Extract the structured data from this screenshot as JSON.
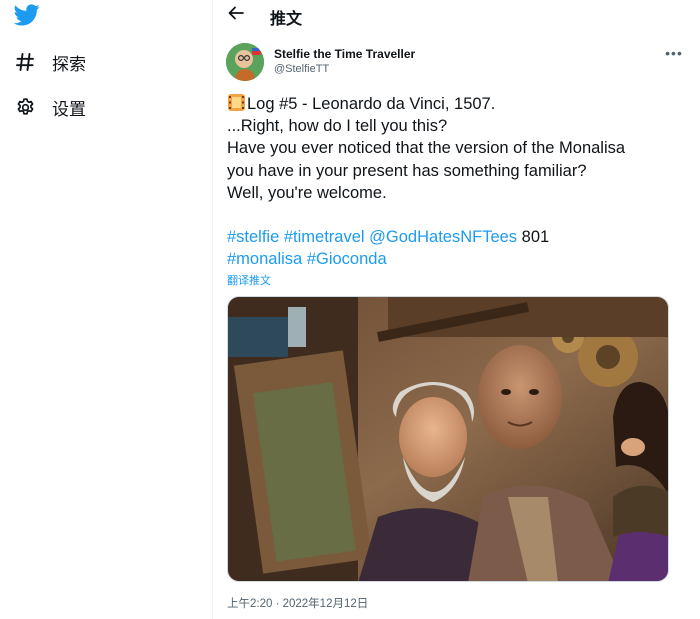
{
  "sidebar": {
    "logo": "twitter-bird-icon",
    "items": [
      {
        "label": "探索",
        "icon": "hashtag-icon"
      },
      {
        "label": "设置",
        "icon": "gear-icon"
      }
    ]
  },
  "header": {
    "back_icon": "arrow-left-icon",
    "title": "推文"
  },
  "tweet": {
    "author_name": "Stelfie the Time Traveller",
    "author_handle": "@StelfieTT",
    "more_label": "•••",
    "lines": [
      "Log #5 - Leonardo da Vinci, 1507.",
      "...Right, how do I tell you this?",
      "Have you ever noticed that the version of the Monalisa",
      "you have in your present has something familiar?",
      "Well, you're welcome."
    ],
    "emoji": "film-frames-icon",
    "tags_line1": [
      "#stelfie",
      "#timetravel",
      "@GodHatesNFTees"
    ],
    "tags_line1_suffix": "801",
    "tags_line2": [
      "#monalisa",
      "#Gioconda"
    ],
    "translate_label": "翻译推文",
    "timestamp": "上午2:20 · 2022年12月12日"
  },
  "colors": {
    "accent": "#1d9bf0",
    "text": "#0f1419",
    "muted": "#536471",
    "border": "#eff3f4"
  }
}
